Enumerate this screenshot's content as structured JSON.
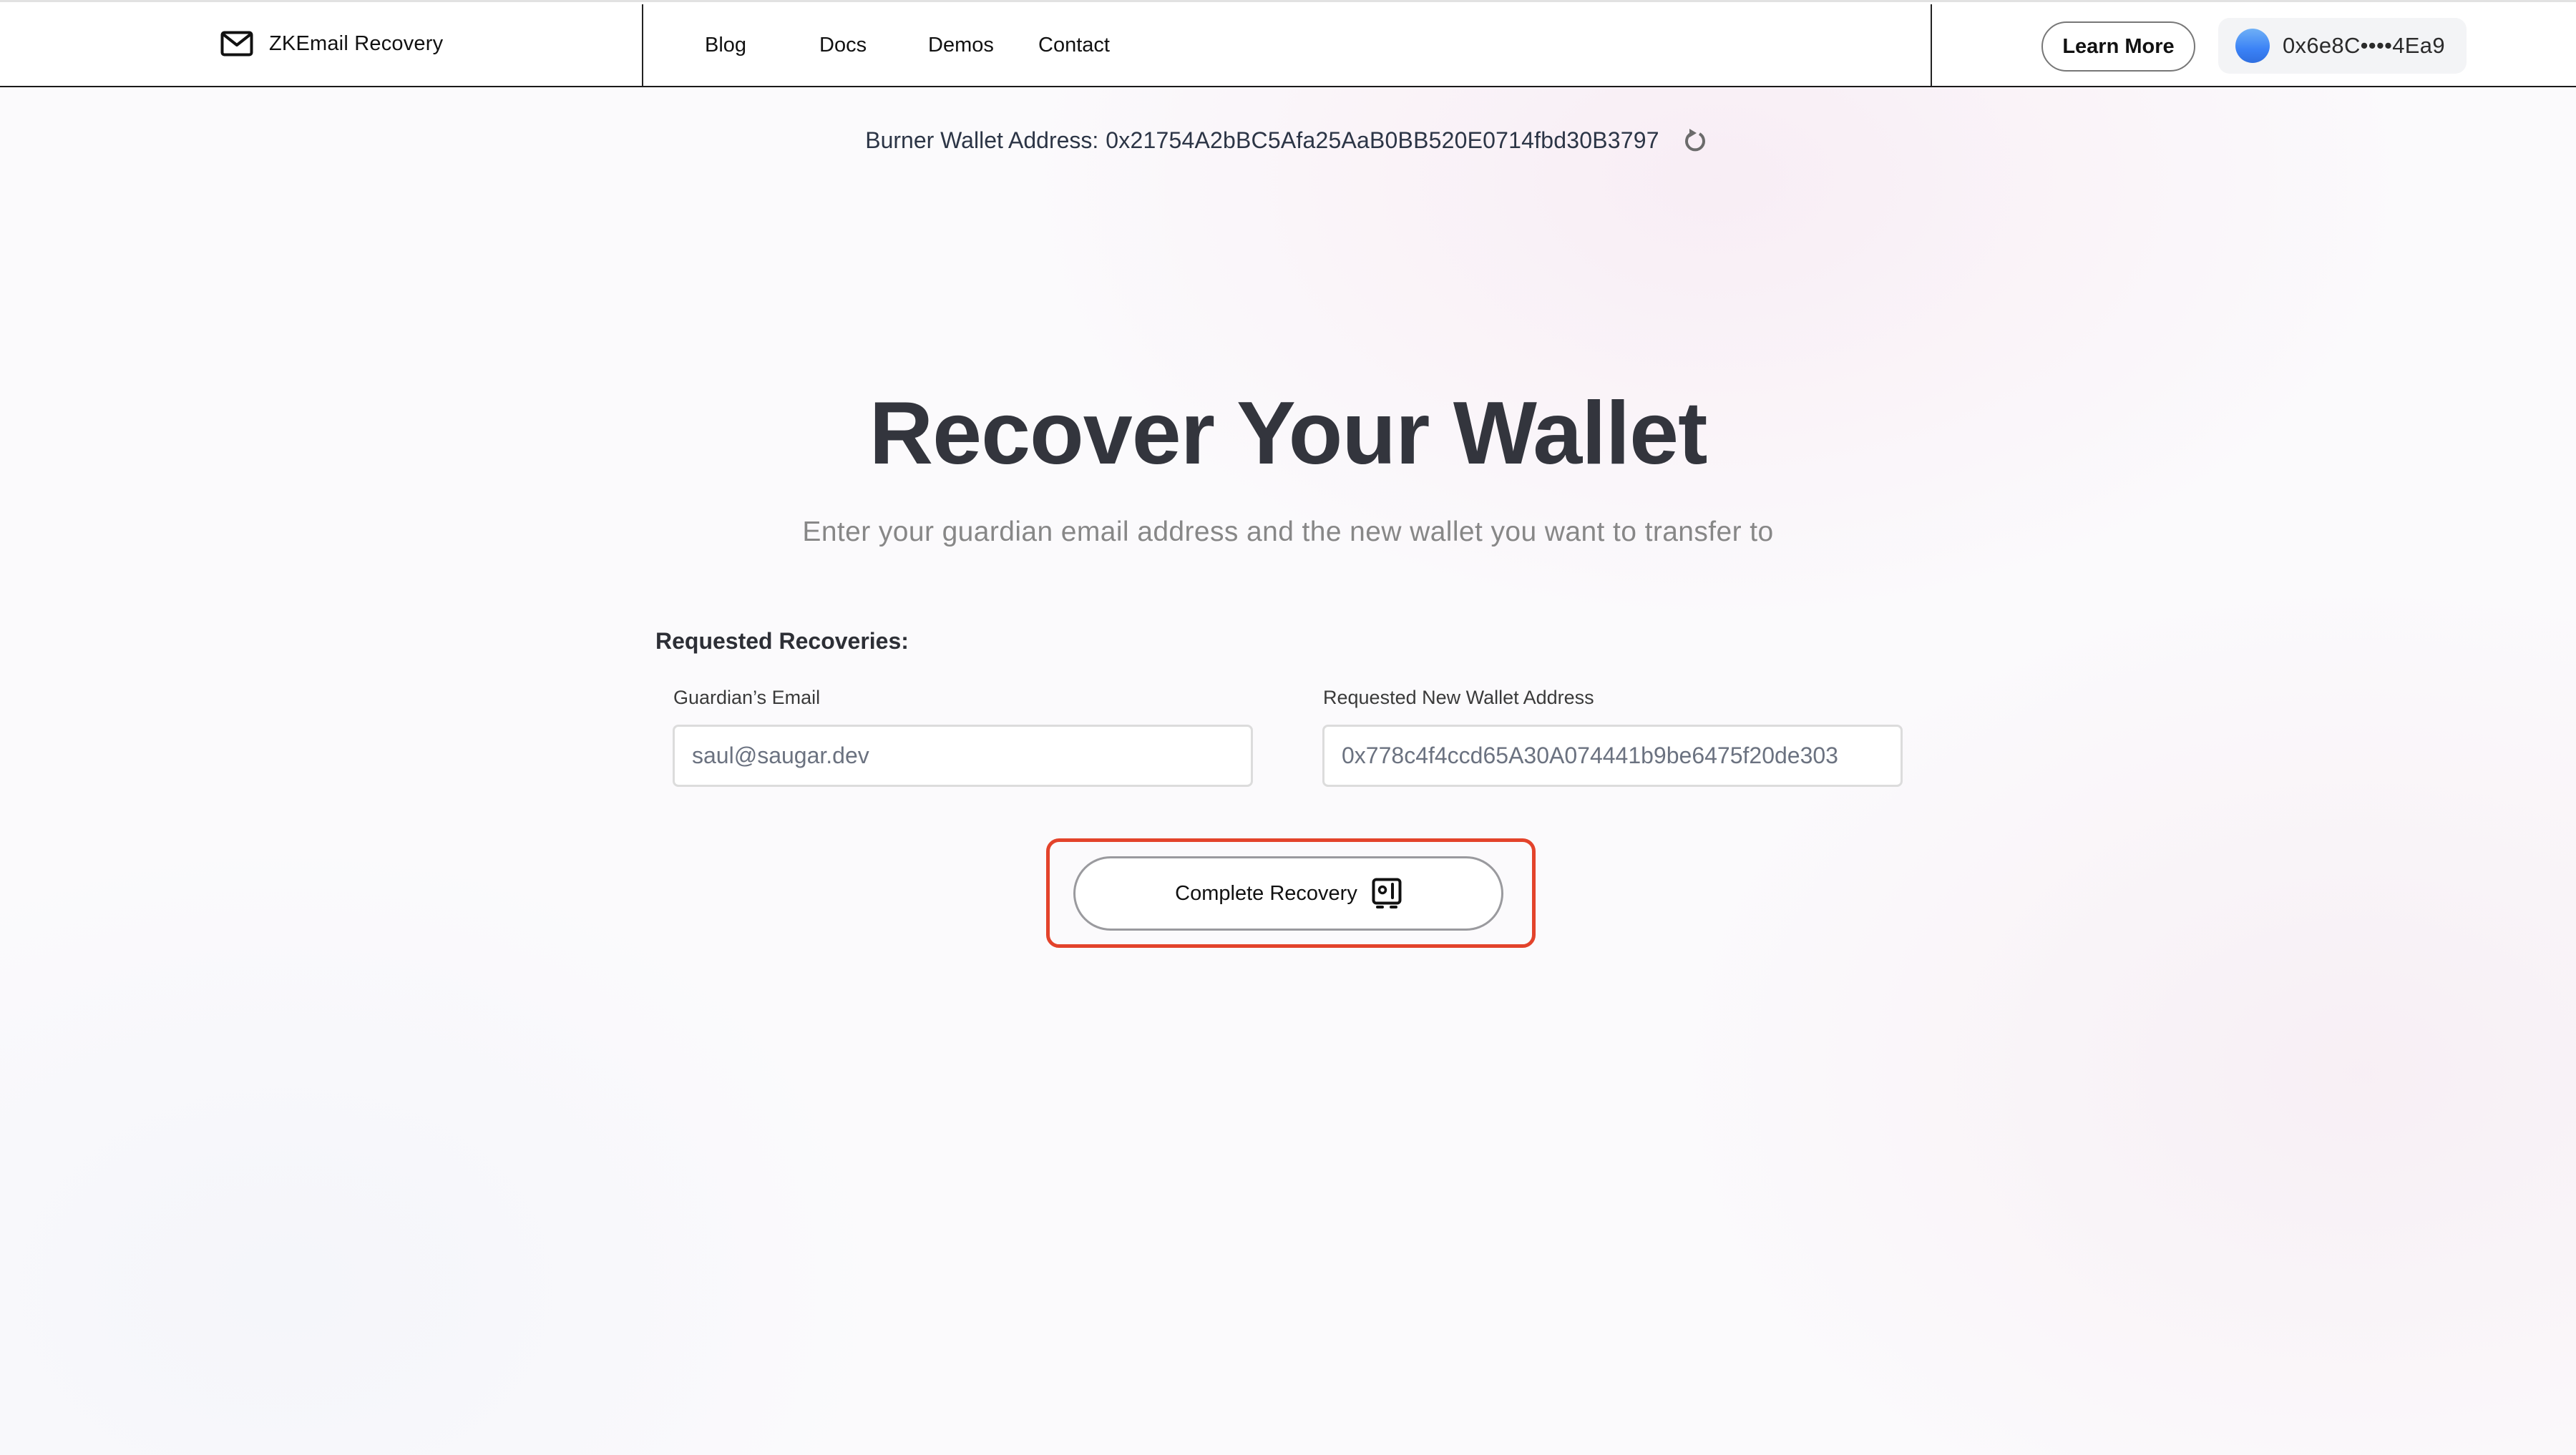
{
  "navbar": {
    "logo_icon": "mail-icon",
    "brand": "ZKEmail Recovery",
    "links": [
      {
        "label": "Blog"
      },
      {
        "label": "Docs"
      },
      {
        "label": "Demos"
      },
      {
        "label": "Contact"
      }
    ],
    "learn_more_label": "Learn More",
    "wallet": {
      "avatar_icon": "wallet-avatar-icon",
      "avatar_color": "#3b82f6",
      "address": "0x6e8C••••4Ea9"
    }
  },
  "burner": {
    "label": "Burner Wallet Address:",
    "address": "0x21754A2bBC5Afa25AaB0BB520E0714fbd30B3797",
    "refresh_icon": "refresh-icon"
  },
  "hero": {
    "title": "Recover Your Wallet",
    "subtitle": "Enter your guardian email address and the new wallet you want to transfer to"
  },
  "form": {
    "section_title": "Requested Recoveries:",
    "guardian_email": {
      "label": "Guardian’s Email",
      "value": "saul@saugar.dev"
    },
    "new_wallet": {
      "label": "Requested New Wallet Address",
      "value": "0x778c4f4ccd65A30A074441b9be6475f20de303"
    },
    "complete_button": {
      "label": "Complete Recovery",
      "icon": "safe-icon"
    }
  },
  "colors": {
    "highlight": "#e3432b",
    "title": "#33353d",
    "subtitle": "#878787",
    "accent_blue": "#3b82f6"
  }
}
